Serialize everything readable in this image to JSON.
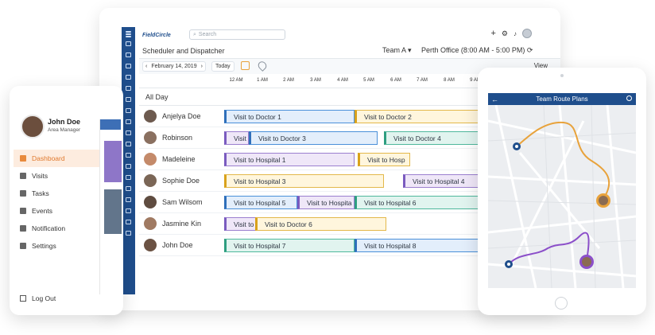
{
  "scheduler": {
    "brand": "FieldCircle",
    "search_placeholder": "Search",
    "page_title": "Scheduler and Dispatcher",
    "team": "Team A",
    "office": "Perth Office (8:00 AM - 5:00 PM)",
    "date": "February 14, 2019",
    "today_label": "Today",
    "view_label": "View",
    "hours": [
      "12 AM",
      "1 AM",
      "2 AM",
      "3 AM",
      "4 AM",
      "5 AM",
      "6 AM",
      "7 AM",
      "8 AM",
      "9 AM"
    ],
    "all_day_label": "All Day",
    "rows": [
      {
        "name": "Anjelya Doe",
        "events": [
          {
            "label": "Visit to Doctor 1",
            "color": "blue"
          },
          {
            "label": "Visit to Doctor 2",
            "color": "yellow"
          }
        ]
      },
      {
        "name": "Robinson",
        "events": [
          {
            "label": "Visit",
            "color": "purple"
          },
          {
            "label": "Visit to Doctor 3",
            "color": "blue"
          },
          {
            "label": "Visit to Doctor 4",
            "color": "teal"
          }
        ]
      },
      {
        "name": "Madeleine",
        "events": [
          {
            "label": "Visit to Hospital 1",
            "color": "purple"
          },
          {
            "label": "Visit to Hosp",
            "color": "yellow"
          }
        ]
      },
      {
        "name": "Sophie Doe",
        "events": [
          {
            "label": "Visit to Hospital 3",
            "color": "yellow"
          },
          {
            "label": "Visit to Hospital 4",
            "color": "purple"
          }
        ]
      },
      {
        "name": "Sam Wilsom",
        "events": [
          {
            "label": "Visit to Hospital 5",
            "color": "blue"
          },
          {
            "label": "Visit to Hospita",
            "color": "purple"
          },
          {
            "label": "Visit to Hospital 6",
            "color": "teal"
          }
        ]
      },
      {
        "name": "Jasmine Kin",
        "events": [
          {
            "label": "Visit to",
            "color": "purple"
          },
          {
            "label": "Visit to Doctor 6",
            "color": "yellow"
          }
        ]
      },
      {
        "name": "John Doe",
        "events": [
          {
            "label": "Visit to Hospital 7",
            "color": "teal"
          },
          {
            "label": "Visit to Hospital 8",
            "color": "blue"
          }
        ]
      }
    ]
  },
  "phone": {
    "user_name": "John Doe",
    "user_role": "Area Manager",
    "menu": [
      "Dashboard",
      "Visits",
      "Tasks",
      "Events",
      "Notification",
      "Settings"
    ],
    "active_menu": "Dashboard",
    "logout_label": "Log Out"
  },
  "ipad": {
    "title": "Team Route Plans"
  },
  "colors": {
    "brand_blue": "#1f4e8c",
    "accent_orange": "#e88a3c",
    "route_orange": "#e8a23b",
    "route_purple": "#8b4fc9"
  }
}
